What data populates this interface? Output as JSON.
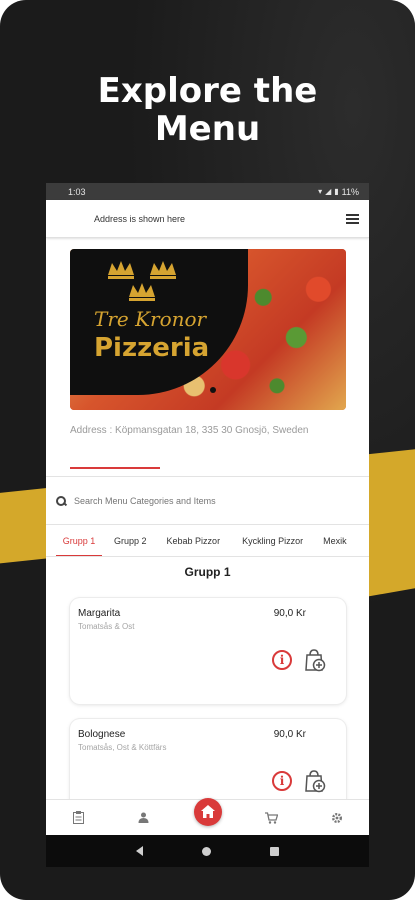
{
  "promo": {
    "headline_line1": "Explore the",
    "headline_line2": "Menu",
    "colors": {
      "background": "#1b1b1b",
      "gold": "#d4a82a",
      "accent_red": "#d93a3a"
    }
  },
  "statusbar": {
    "time": "1:03",
    "battery": "11%"
  },
  "appbar": {
    "address_placeholder": "Address is shown here",
    "menu_icon": "hamburger-icon"
  },
  "banner": {
    "brand_line1": "Tre Kronor",
    "brand_line2": "Pizzeria",
    "logo_icon": "three-crowns-icon"
  },
  "restaurant": {
    "address": "Address : Köpmansgatan 18, 335 30 Gnosjö, Sweden"
  },
  "search": {
    "placeholder": "Search Menu Categories and Items",
    "icon": "search-icon"
  },
  "tabs": [
    {
      "label": "Grupp 1",
      "active": true
    },
    {
      "label": "Grupp 2",
      "active": false
    },
    {
      "label": "Kebab Pizzor",
      "active": false
    },
    {
      "label": "Kyckling Pizzor",
      "active": false
    },
    {
      "label": "Mexik",
      "active": false
    }
  ],
  "group": {
    "title": "Grupp 1"
  },
  "items": [
    {
      "name": "Margarita",
      "description": "Tomatsås & Ost",
      "price": "90,0 Kr"
    },
    {
      "name": "Bolognese",
      "description": "Tomatsås, Ost & Köttfärs",
      "price": "90,0 Kr"
    }
  ],
  "bottom_nav": [
    {
      "icon": "clipboard-icon"
    },
    {
      "icon": "user-icon"
    },
    {
      "icon": "home-icon",
      "active": true
    },
    {
      "icon": "cart-icon"
    },
    {
      "icon": "settings-icon"
    }
  ]
}
